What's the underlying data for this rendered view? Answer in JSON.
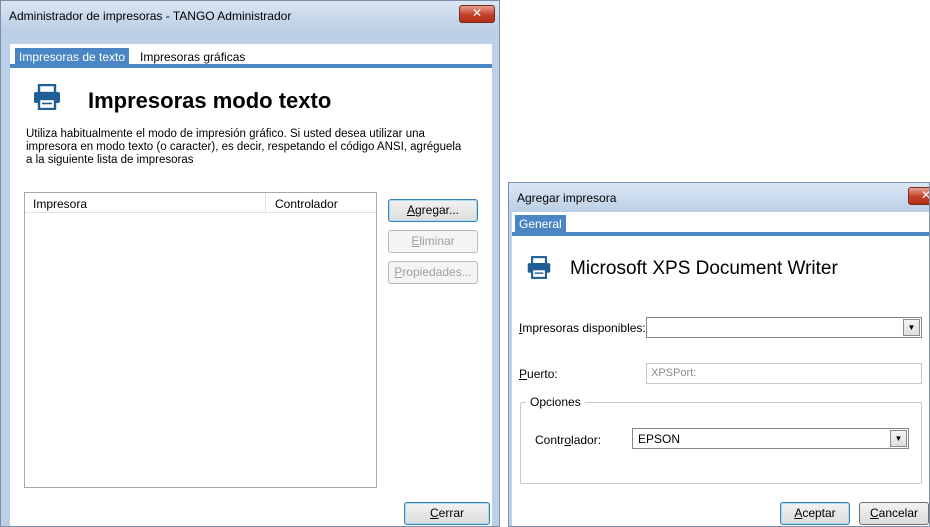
{
  "admin_window": {
    "title": "Administrador de impresoras - TANGO Administrador",
    "close_glyph": "✕",
    "tabs": [
      "Impresoras de texto",
      "Impresoras gráficas"
    ],
    "header": "Impresoras modo texto",
    "header_icon": "printer-icon",
    "description": [
      "Utiliza habitualmente el modo de impresión gráfico. Si usted desea utilizar una",
      "impresora en modo texto (o caracter), es decir, respetando el código ANSI, agréguela",
      "a la siguiente lista de impresoras"
    ],
    "columns": [
      "Impresora",
      "Controlador"
    ],
    "buttons": {
      "add": {
        "accel": "A",
        "rest": "gregar..."
      },
      "delete": {
        "accel": "E",
        "rest": "liminar"
      },
      "properties": {
        "accel": "P",
        "rest": "ropiedades..."
      },
      "close": {
        "accel": "C",
        "rest": "errar"
      }
    }
  },
  "add_window": {
    "title": "Agregar impresora",
    "close_glyph": "✕",
    "tab": "General",
    "header": "Microsoft XPS Document Writer",
    "header_icon": "printer-icon",
    "available_label": {
      "accel": "I",
      "rest": "mpresoras disponibles:"
    },
    "available_value": "",
    "port_label": {
      "accel": "P",
      "rest": "uerto:"
    },
    "port_value": "XPSPort:",
    "options_group": "Opciones",
    "driver_label": {
      "pre": "Contr",
      "accel": "o",
      "rest": "lador:"
    },
    "driver_value": "EPSON",
    "dropdown_glyph": "▼",
    "buttons": {
      "accept": {
        "accel": "A",
        "rest": "ceptar"
      },
      "cancel": {
        "accel": "C",
        "rest": "ancelar"
      }
    }
  },
  "colors": {
    "accent": "#4a86c4",
    "frame": "#bcd0e6",
    "close": "#c2402a"
  }
}
